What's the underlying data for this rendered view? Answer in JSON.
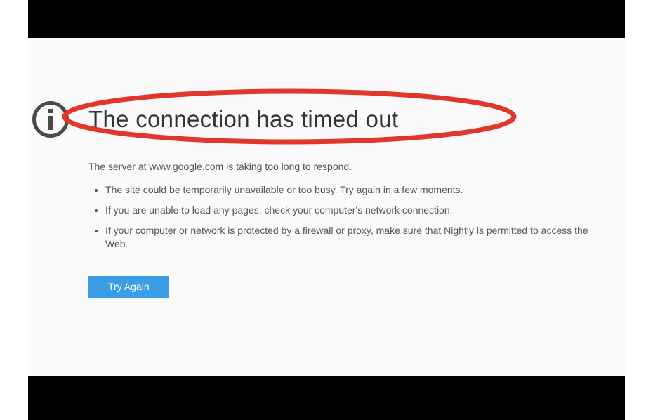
{
  "error": {
    "title": "The connection has timed out",
    "description": "The server at www.google.com is taking too long to respond.",
    "bullets": [
      "The site could be temporarily unavailable or too busy. Try again in a few moments.",
      "If you are unable to load any pages, check your computer's network connection.",
      "If your computer or network is protected by a firewall or proxy, make sure that Nightly is permitted to access the Web."
    ],
    "try_again_label": "Try Again"
  },
  "annotation": {
    "highlight_color": "#e2362a"
  }
}
